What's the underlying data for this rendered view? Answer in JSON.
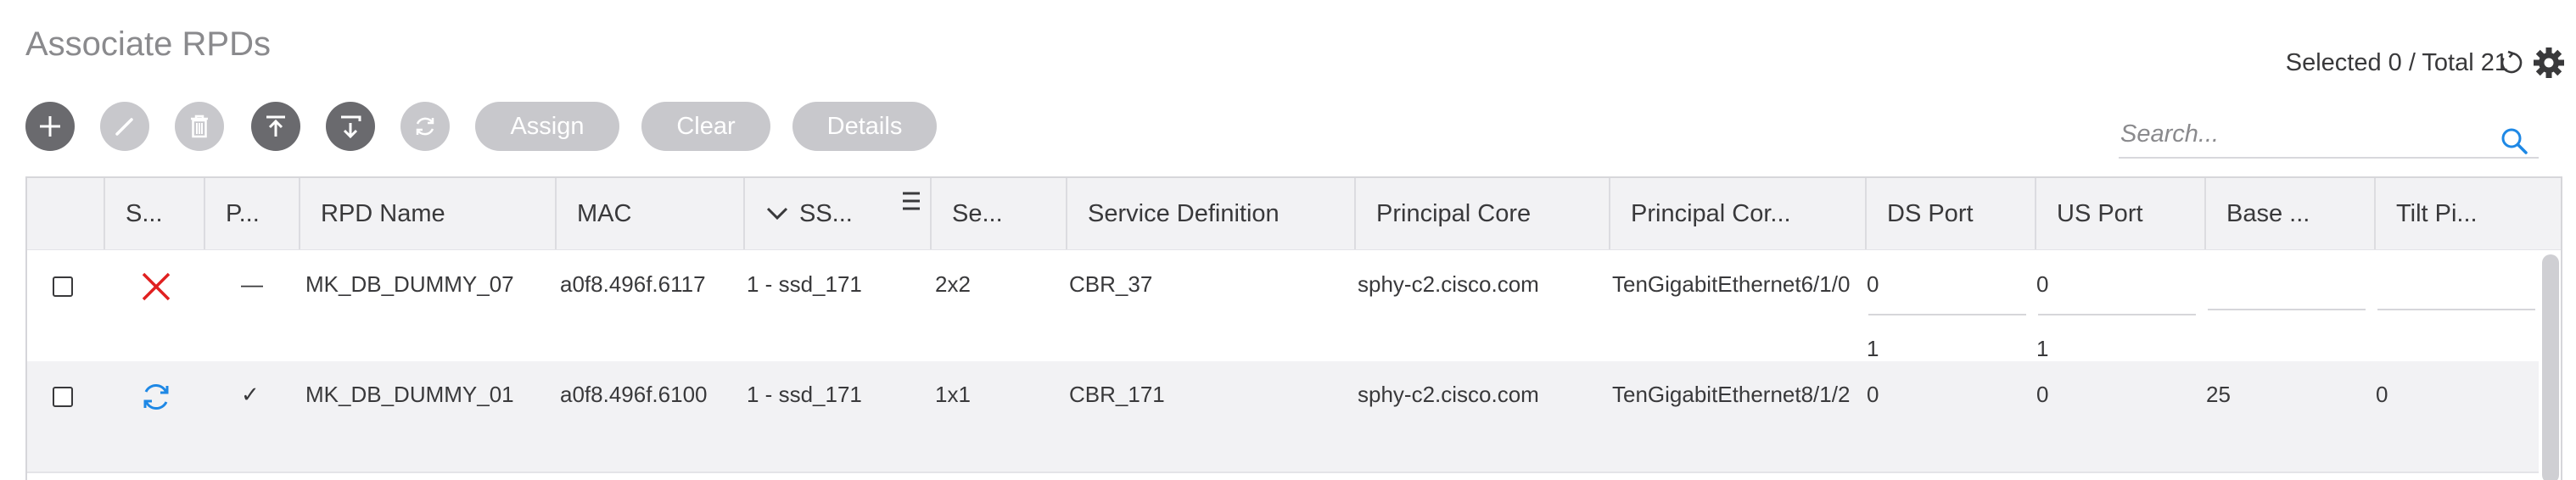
{
  "page": {
    "title": "Associate RPDs"
  },
  "header": {
    "selected_text": "Selected 0 / Total 21",
    "refresh_icon": "refresh-icon",
    "settings_icon": "gear-icon"
  },
  "toolbar": {
    "add_icon": "plus-icon",
    "edit_icon": "pencil-icon",
    "delete_icon": "trash-icon",
    "import_icon": "upload-icon",
    "export_icon": "download-icon",
    "sync_icon": "sync-icon",
    "assign_label": "Assign",
    "clear_label": "Clear",
    "details_label": "Details"
  },
  "search": {
    "placeholder": "Search...",
    "value": ""
  },
  "colors": {
    "dark_button": "#6a6a6e",
    "disabled_button": "#c8c8cc",
    "error_red": "#e02020",
    "sync_blue": "#1e88e5",
    "search_blue": "#1e88e5"
  },
  "table": {
    "columns": [
      "S...",
      "P...",
      "RPD Name",
      "MAC",
      "SS...",
      "Se...",
      "Service Definition",
      "Principal Core",
      "Principal Cor...",
      "DS Port",
      "US Port",
      "Base ...",
      "Tilt Pi..."
    ],
    "sorted_column_icon": "chevron-down-icon",
    "rows": [
      {
        "status_icon": "error-x-icon",
        "p": "—",
        "rpd_name": "MK_DB_DUMMY_07",
        "mac": "a0f8.496f.6117",
        "ss": "1 - ssd_171",
        "se": "2x2",
        "service_definition": "CBR_37",
        "principal_core": "sphy-c2.cisco.com",
        "principal_core_if": "TenGigabitEthernet6/1/0",
        "ds_port": "0",
        "ds_port_2": "1",
        "us_port": "0",
        "us_port_2": "1",
        "base": "",
        "tilt": ""
      },
      {
        "status_icon": "sync-icon",
        "p": "✓",
        "rpd_name": "MK_DB_DUMMY_01",
        "mac": "a0f8.496f.6100",
        "ss": "1 - ssd_171",
        "se": "1x1",
        "service_definition": "CBR_171",
        "principal_core": "sphy-c2.cisco.com",
        "principal_core_if": "TenGigabitEthernet8/1/2",
        "ds_port": "0",
        "us_port": "0",
        "base": "25",
        "tilt": "0"
      }
    ]
  }
}
